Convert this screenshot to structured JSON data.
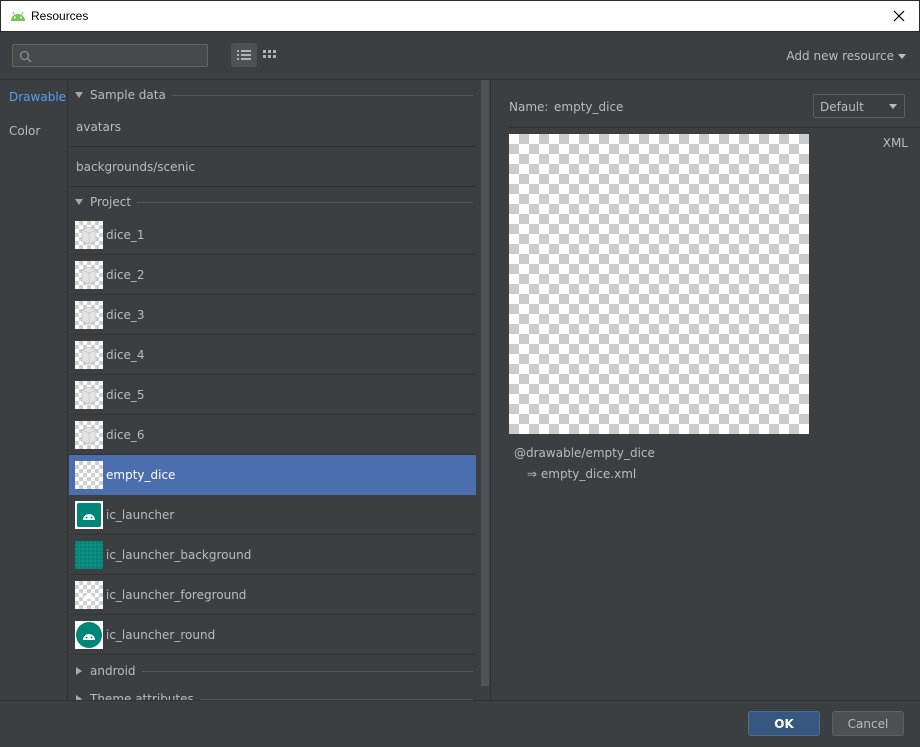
{
  "window": {
    "title": "Resources"
  },
  "toolbar": {
    "search_placeholder": "",
    "add_new_resource": "Add new resource"
  },
  "nav": {
    "items": [
      "Drawable",
      "Color"
    ]
  },
  "list": {
    "sections": {
      "sample_data": "Sample data",
      "project": "Project",
      "android": "android",
      "theme_attributes": "Theme attributes"
    },
    "sample_items": [
      "avatars",
      "backgrounds/scenic"
    ],
    "project_items": [
      "dice_1",
      "dice_2",
      "dice_3",
      "dice_4",
      "dice_5",
      "dice_6",
      "empty_dice",
      "ic_launcher",
      "ic_launcher_background",
      "ic_launcher_foreground",
      "ic_launcher_round"
    ],
    "selected": "empty_dice"
  },
  "detail": {
    "name_label": "Name:",
    "name_value": "empty_dice",
    "config": "Default",
    "xml_label": "XML",
    "reference": "@drawable/empty_dice",
    "file": "⇒ empty_dice.xml"
  },
  "footer": {
    "ok": "OK",
    "cancel": "Cancel"
  },
  "colors": {
    "selection": "#4b6eaf",
    "active_nav": "#589df6",
    "ok_button": "#365880",
    "launcher_teal": "#008577"
  }
}
